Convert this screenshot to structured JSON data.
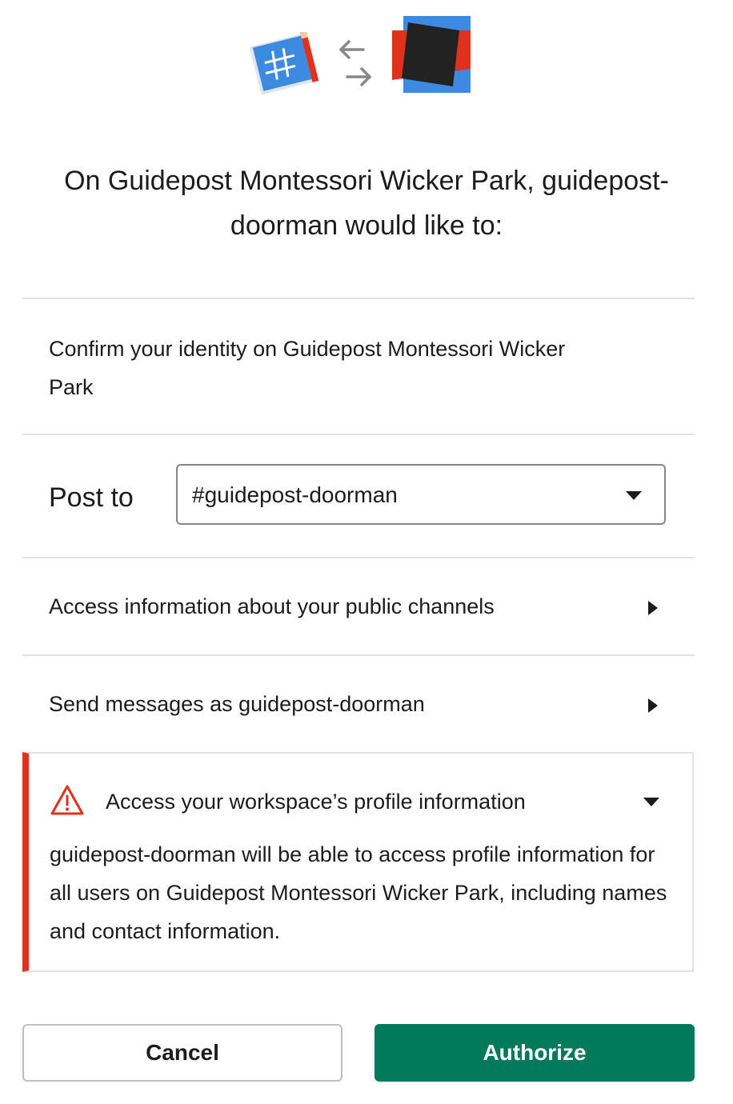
{
  "logos": {
    "app_icon": "slack-hash-blueprint-icon",
    "swap_icon": "exchange-arrows-icon",
    "workspace_icon": "guidepost-logo-icon",
    "colors": {
      "blue": "#3d8be0",
      "red": "#e0301e",
      "black": "#222222"
    }
  },
  "heading": "On Guidepost Montessori Wicker Park, guidepost-doorman would like to:",
  "identity": "Confirm your identity on Guidepost Montessori Wicker Park",
  "post_to": {
    "label": "Post to",
    "selected": "#guidepost-doorman",
    "icon": "caret-down-icon"
  },
  "permissions": [
    {
      "label": "Access information about your public channels",
      "icon": "caret-right-icon"
    },
    {
      "label": "Send messages as guidepost-doorman",
      "icon": "caret-right-icon"
    }
  ],
  "warning": {
    "title": "Access your workspace’s profile information",
    "description": "guidepost-doorman will be able to access profile information for all users on Guidepost Montessori Wicker Park, including names and contact information.",
    "icon": "warning-triangle-icon",
    "accent": "#e0301e"
  },
  "buttons": {
    "cancel": "Cancel",
    "authorize": "Authorize",
    "authorize_color": "#007a5a"
  }
}
